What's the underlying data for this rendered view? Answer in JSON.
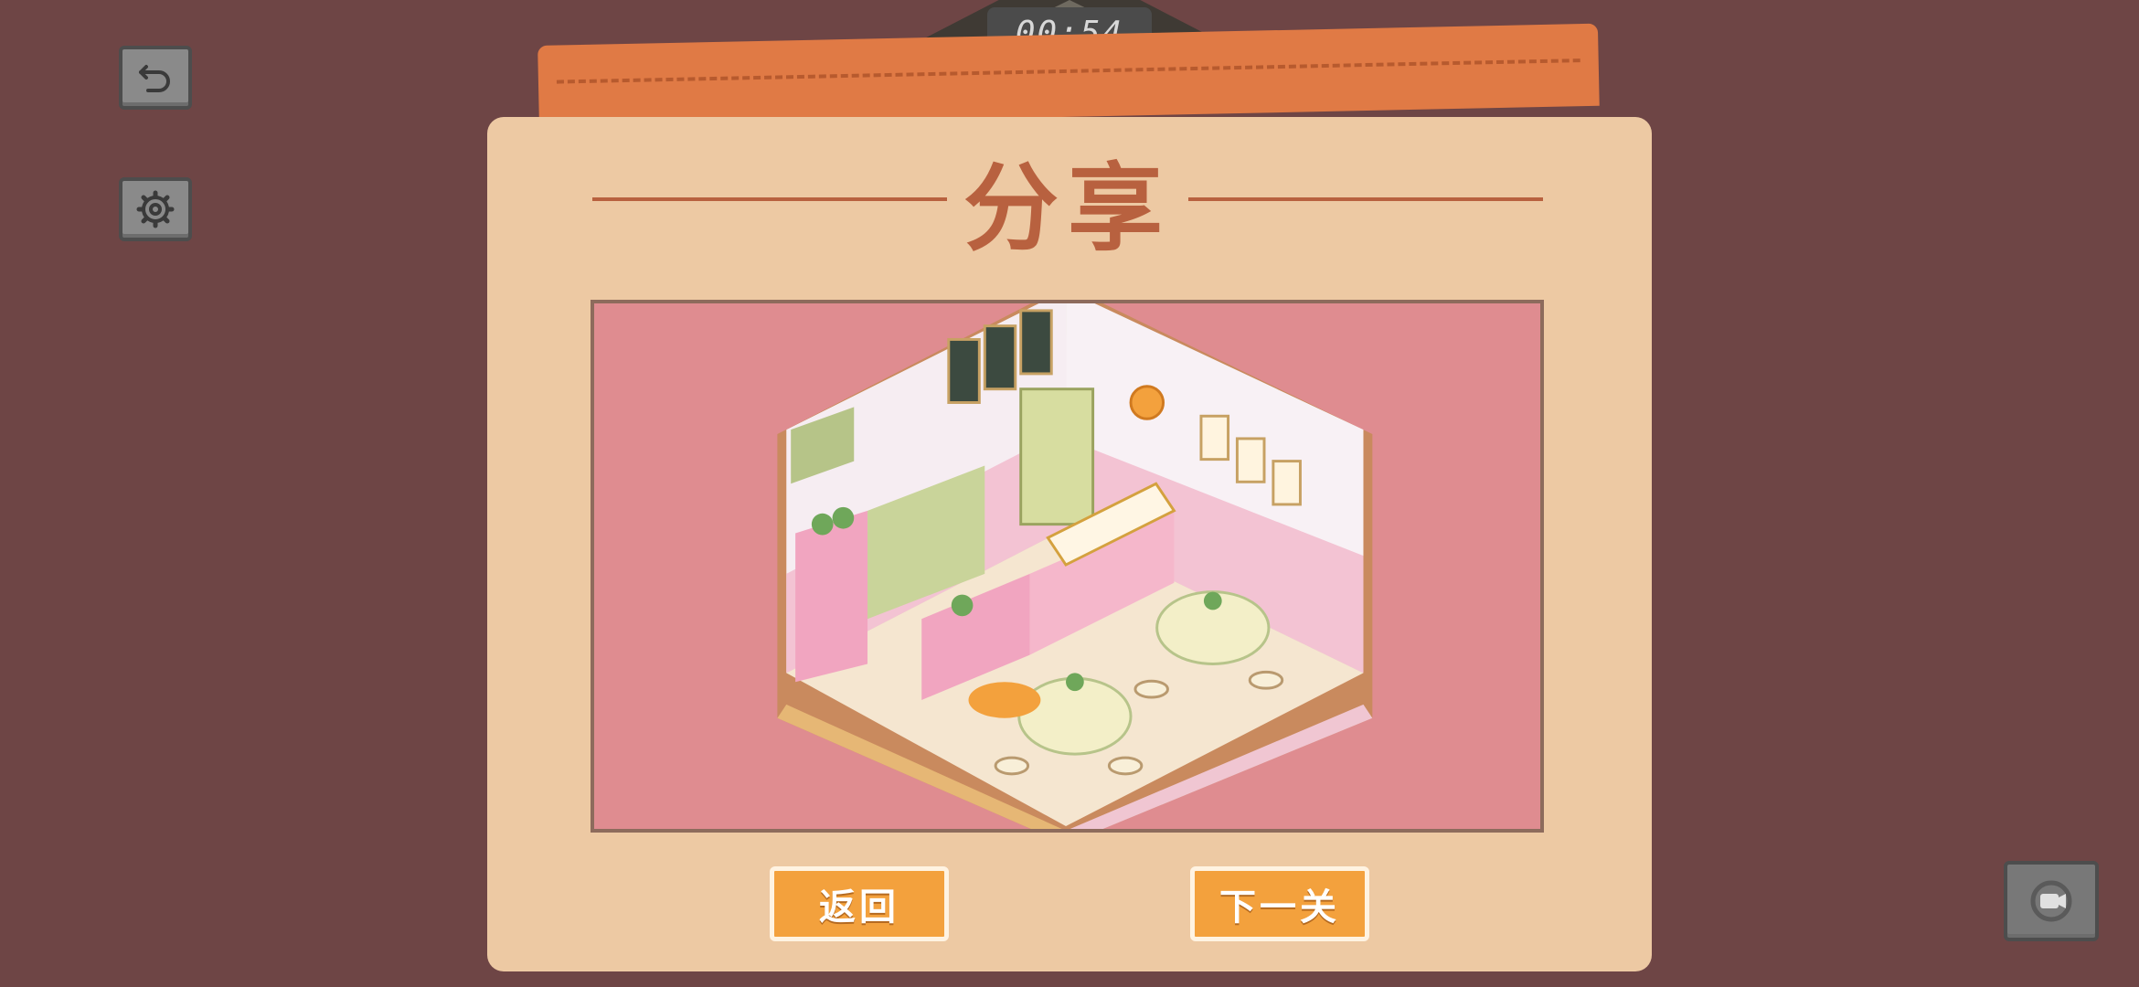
{
  "hud": {
    "timer": "00:54",
    "back_icon": "undo-arrow-icon",
    "settings_icon": "gear-icon",
    "record_icon": "video-camera-icon"
  },
  "dialog": {
    "title": "分享",
    "preview_label": "isometric-cafe-room",
    "return_label": "返回",
    "next_label": "下一关"
  },
  "colors": {
    "background": "#6e4545",
    "dialog": "#edc9a3",
    "accent": "#b8613f",
    "button": "#f3a13d",
    "tab": "#e07a45",
    "preview_bg": "#df8c90"
  }
}
